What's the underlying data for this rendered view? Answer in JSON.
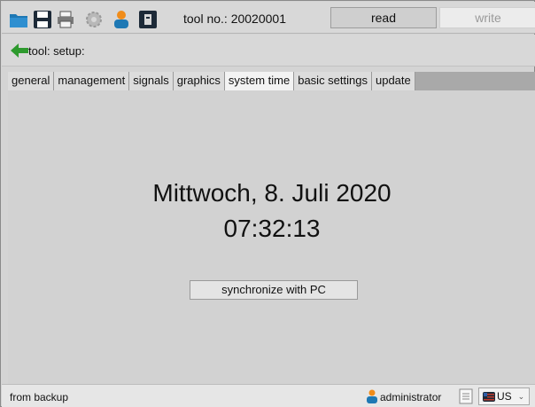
{
  "toolbar": {
    "icons": [
      "folder-icon",
      "save-icon",
      "print-icon",
      "settings-icon",
      "user-icon",
      "device-icon"
    ],
    "tool_no": "tool no.: 20020001",
    "read_label": "read",
    "write_label": "write"
  },
  "breadcrumb": {
    "text": "tool: setup:"
  },
  "tabs": [
    {
      "label": "general",
      "active": false
    },
    {
      "label": "management",
      "active": false
    },
    {
      "label": "signals",
      "active": false
    },
    {
      "label": "graphics",
      "active": false
    },
    {
      "label": "system time",
      "active": true
    },
    {
      "label": "basic settings",
      "active": false
    },
    {
      "label": "update",
      "active": false
    }
  ],
  "main": {
    "date": "Mittwoch, 8. Juli 2020",
    "time": "07:32:13",
    "sync_label": "synchronize with PC"
  },
  "status": {
    "left_text": "from backup",
    "user": "administrator",
    "language": "US"
  },
  "colors": {
    "folder": "#1e78b4",
    "back_arrow": "#2e9a2e",
    "user_orange": "#f08c1a",
    "user_blue": "#1e78b4"
  }
}
